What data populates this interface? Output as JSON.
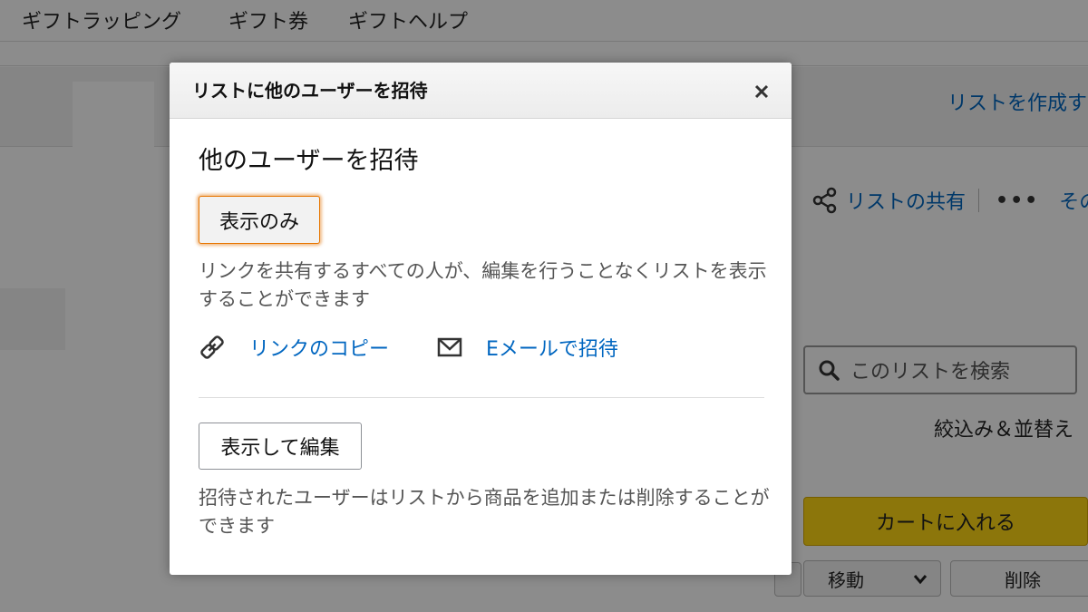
{
  "background": {
    "top_nav": [
      "ギフトラッピング",
      "ギフト券",
      "ギフトヘルプ"
    ],
    "create_list_link": "リストを作成す",
    "share_link": "リストの共有",
    "more_link": "その",
    "search_placeholder": "このリストを検索",
    "filter_sort": "絞込み＆並替え",
    "add_to_cart": "カートに入れる",
    "move_select": "移動",
    "delete_button": "削除"
  },
  "modal": {
    "title": "リストに他のユーザーを招待",
    "close_label": "×",
    "section_title": "他のユーザーを招待",
    "view_only_button": "表示のみ",
    "view_only_desc": "リンクを共有するすべての人が、編集を行うことなくリストを表示することができます",
    "copy_link": "リンクのコピー",
    "email_invite": "Eメールで招待",
    "view_edit_button": "表示して編集",
    "view_edit_desc": "招待されたユーザーはリストから商品を追加または削除することができます"
  },
  "colors": {
    "link": "#0066c0",
    "focus_ring": "#e77600",
    "cart_button": "#ffd814"
  },
  "icons": [
    "link-icon",
    "mail-icon",
    "close-icon",
    "share-icon",
    "search-icon",
    "chevron-down-icon"
  ]
}
